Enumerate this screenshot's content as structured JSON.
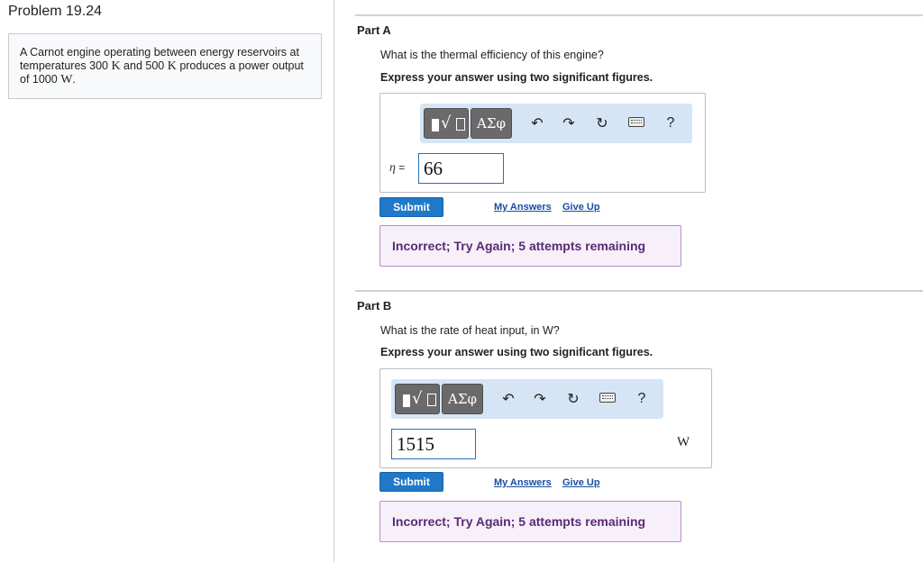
{
  "problem": {
    "title": "Problem 19.24",
    "text_part1": "A Carnot engine operating between energy reservoirs at temperatures 300 ",
    "unit_K1": "K",
    "text_part2": " and 500 ",
    "unit_K2": "K",
    "text_part3": " produces a power output of 1000 ",
    "unit_W": "W",
    "text_part4": "."
  },
  "toolbar": {
    "templates_icon": "radical-template-icon",
    "greek_label": "ΑΣφ",
    "undo_icon": "undo-icon",
    "redo_icon": "redo-icon",
    "reset_icon": "reset-icon",
    "keyboard_icon": "keyboard-icon",
    "help_label": "?"
  },
  "part_a": {
    "label": "Part A",
    "question": "What is the thermal efficiency of this engine?",
    "instruction": "Express your answer using two significant figures.",
    "variable": "η",
    "equals": "=",
    "answer_value": "66",
    "submit_label": "Submit",
    "my_answers_label": "My Answers",
    "give_up_label": "Give Up",
    "feedback": "Incorrect; Try Again; 5 attempts remaining"
  },
  "part_b": {
    "label": "Part B",
    "question": "What is the rate of heat input, in W?",
    "instruction": "Express your answer using two significant figures.",
    "answer_value": "1515",
    "unit": "W",
    "submit_label": "Submit",
    "my_answers_label": "My Answers",
    "give_up_label": "Give Up",
    "feedback": "Incorrect; Try Again; 5 attempts remaining"
  },
  "colors": {
    "submit_blue": "#1f78c8",
    "feedback_purple": "#5a2a73",
    "toolbar_bg": "#d5e5f5",
    "link_blue": "#1a4ea0"
  }
}
